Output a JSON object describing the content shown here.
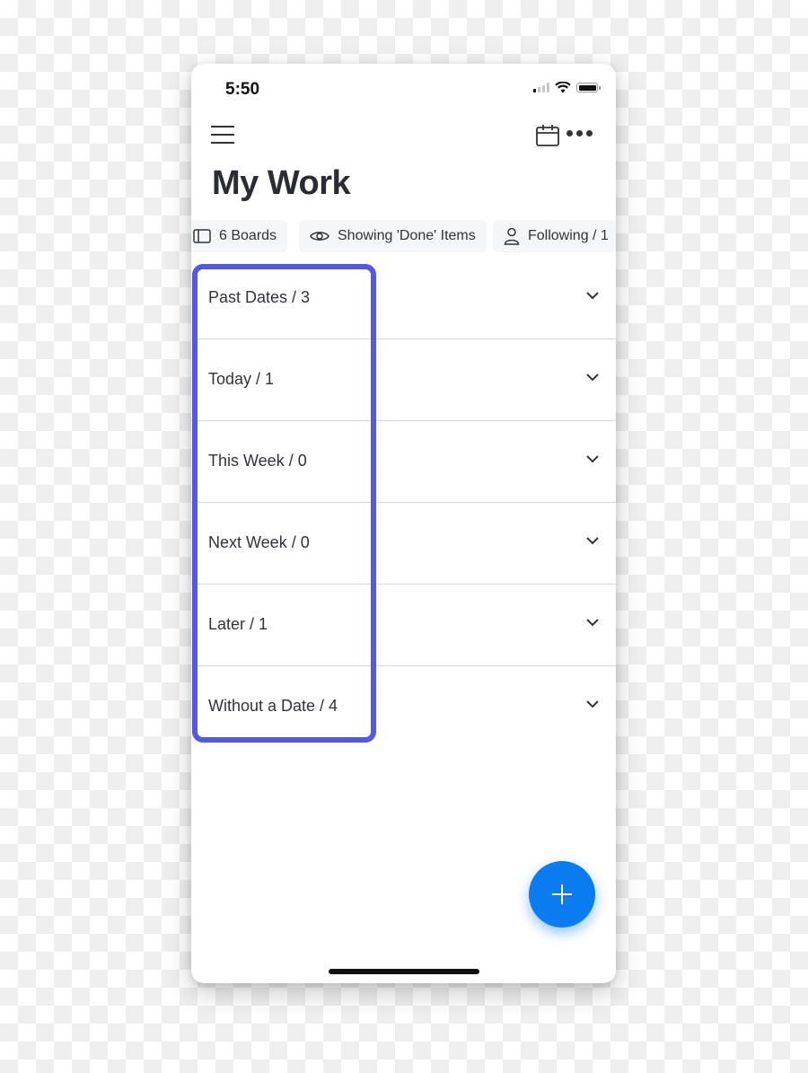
{
  "status_bar": {
    "time": "5:50"
  },
  "header": {
    "title": "My Work"
  },
  "filters": [
    {
      "label": "6 Boards",
      "icon": "board-icon"
    },
    {
      "label": "Showing 'Done' Items",
      "icon": "eye-icon"
    },
    {
      "label": "Following / 1",
      "icon": "person-icon"
    }
  ],
  "groups": [
    {
      "label": "Past Dates / 3"
    },
    {
      "label": "Today / 1"
    },
    {
      "label": "This Week / 0"
    },
    {
      "label": "Next Week / 0"
    },
    {
      "label": "Later / 1"
    },
    {
      "label": "Without a Date / 4"
    }
  ],
  "colors": {
    "highlight": "#5559df",
    "fab": "#0a7cf0",
    "text": "#323338"
  }
}
